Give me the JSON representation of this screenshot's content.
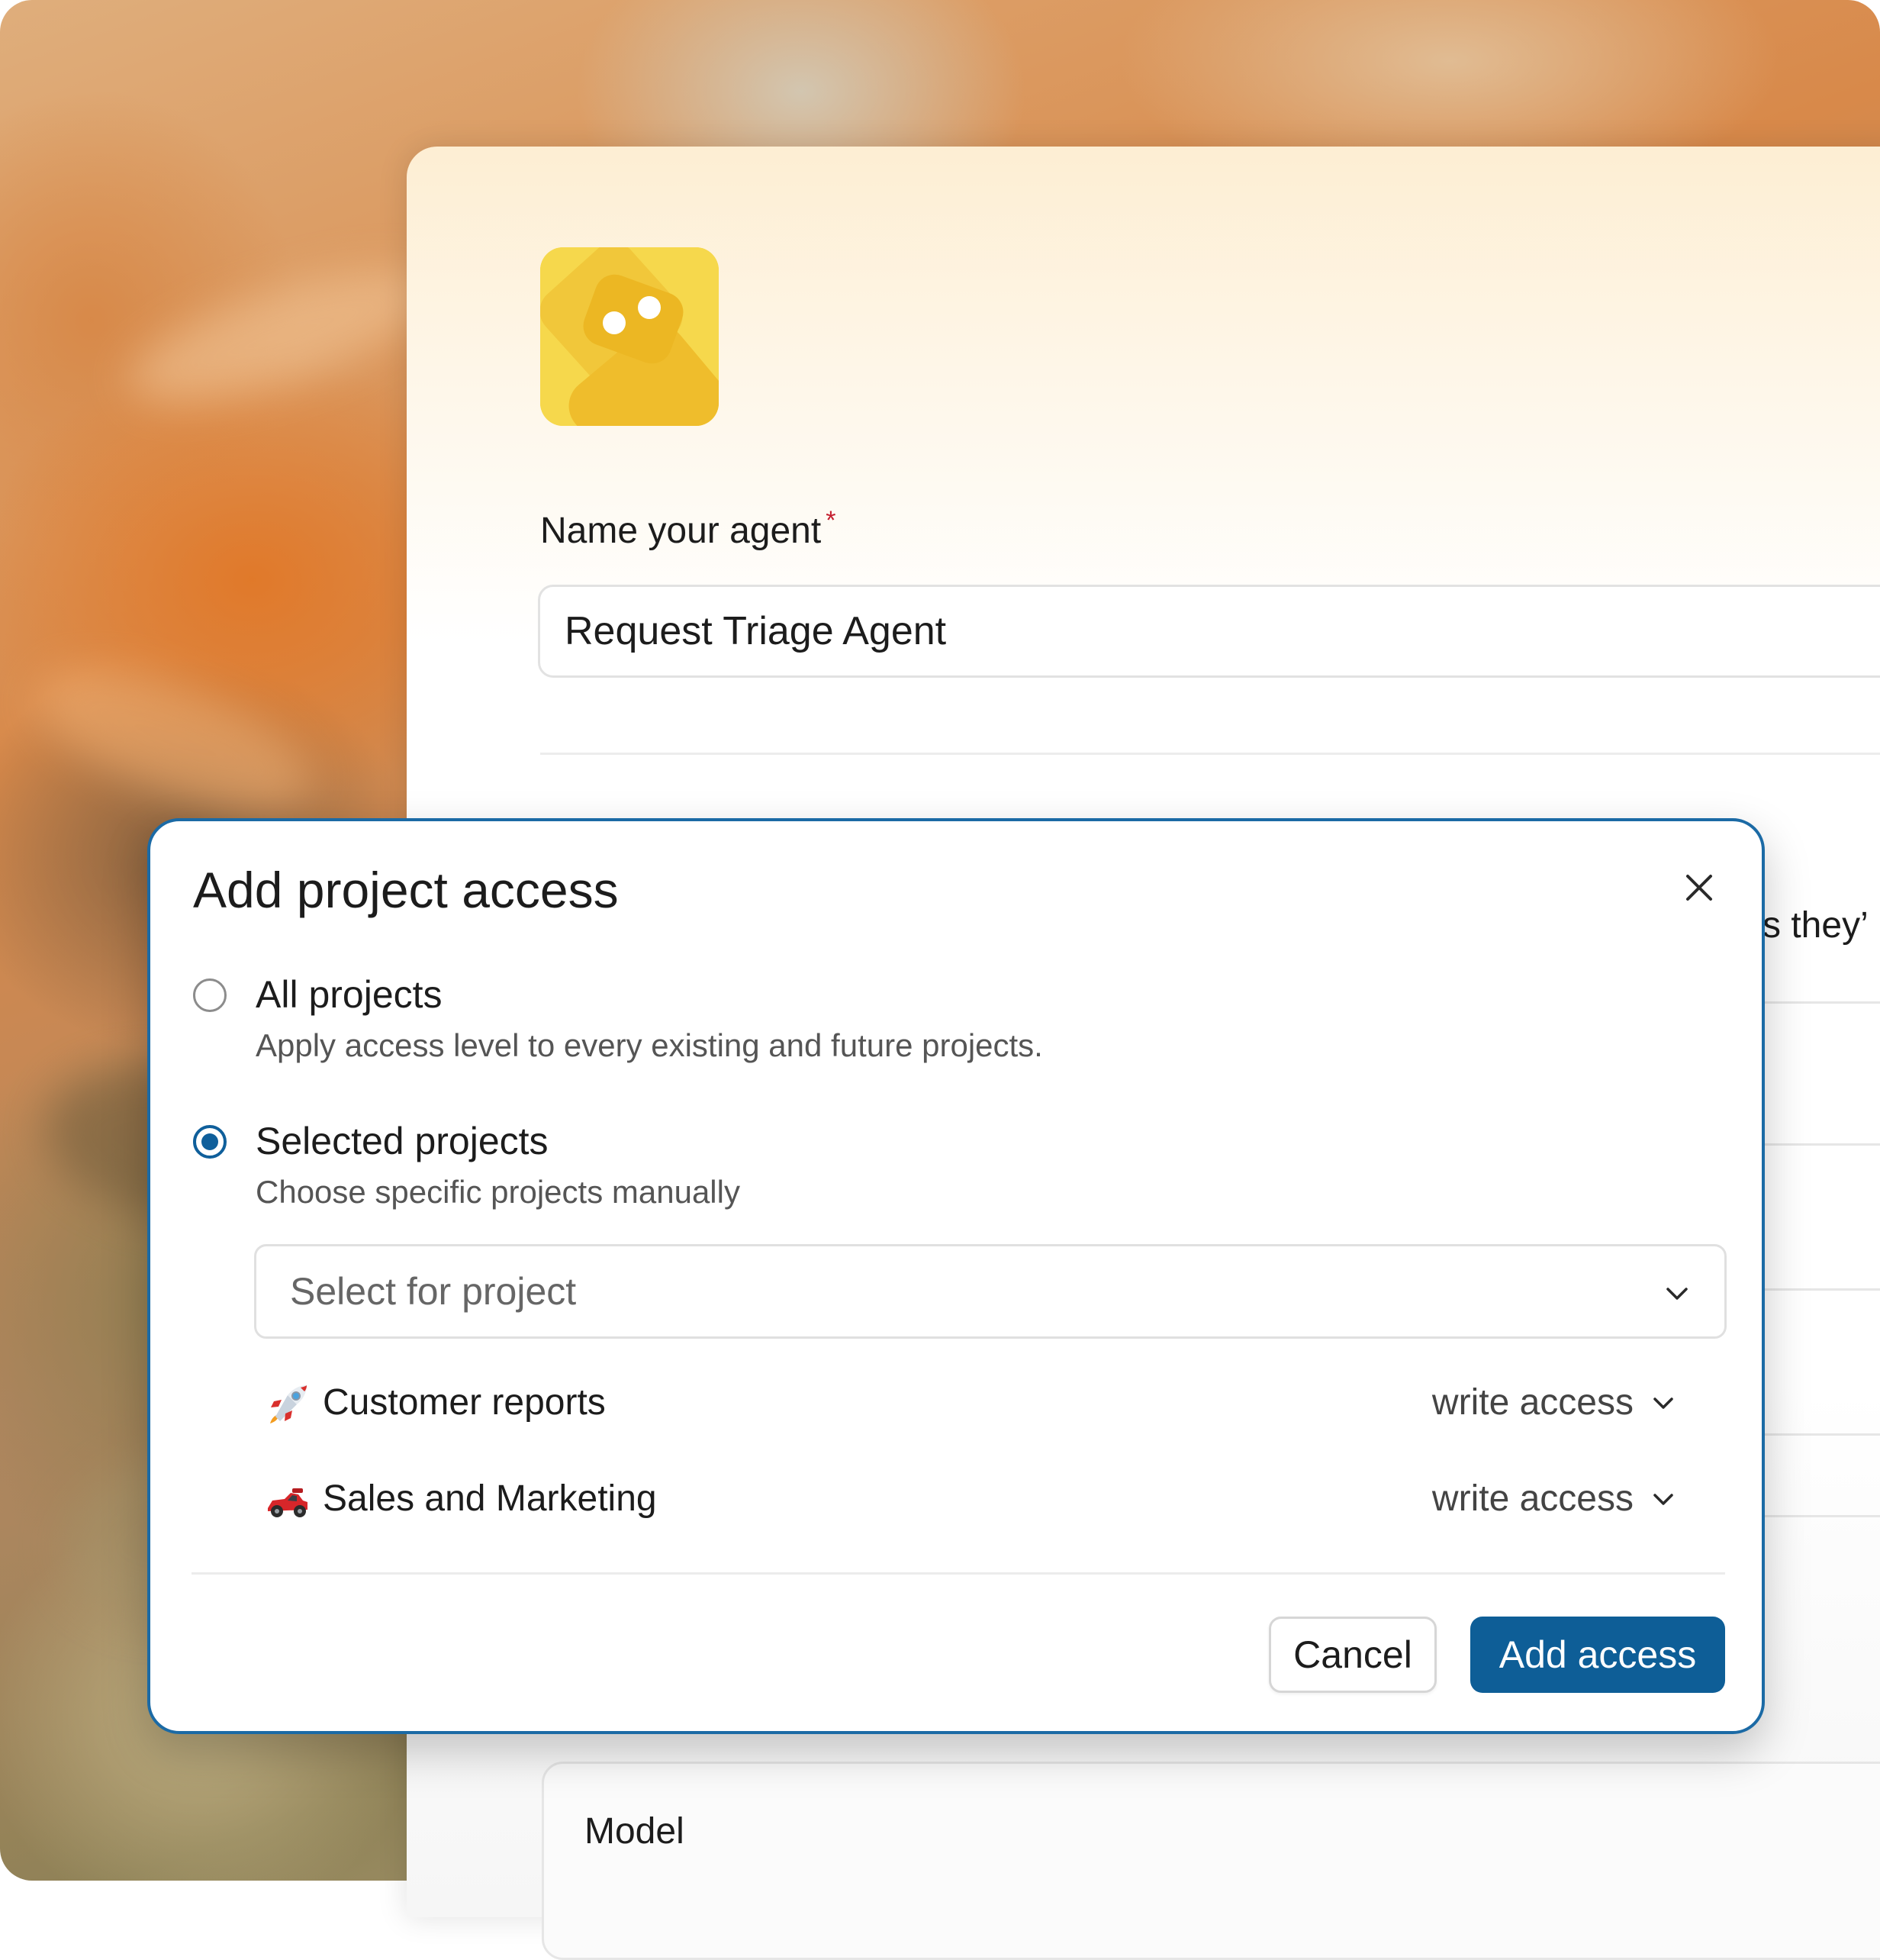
{
  "agent_form": {
    "name_label": "Name your agent",
    "required_mark": "*",
    "name_value": "Request Triage Agent",
    "peek_text": "s they’",
    "model_label": "Model"
  },
  "modal": {
    "title": "Add project access",
    "options": [
      {
        "label": "All projects",
        "description": "Apply access level to every existing and future projects.",
        "selected": false
      },
      {
        "label": "Selected projects",
        "description": "Choose specific projects manually",
        "selected": true
      }
    ],
    "select": {
      "placeholder": "Select for project"
    },
    "projects": [
      {
        "icon": "rocket-icon",
        "name": "Customer reports",
        "access": "write access"
      },
      {
        "icon": "race-car-icon",
        "name": "Sales and Marketing",
        "access": "write access"
      }
    ],
    "cancel_label": "Cancel",
    "confirm_label": "Add access"
  },
  "colors": {
    "accent": "#0e5e97",
    "modal_border": "#1b6aa5",
    "required": "#c41e2e",
    "avatar": "#f5d547"
  }
}
